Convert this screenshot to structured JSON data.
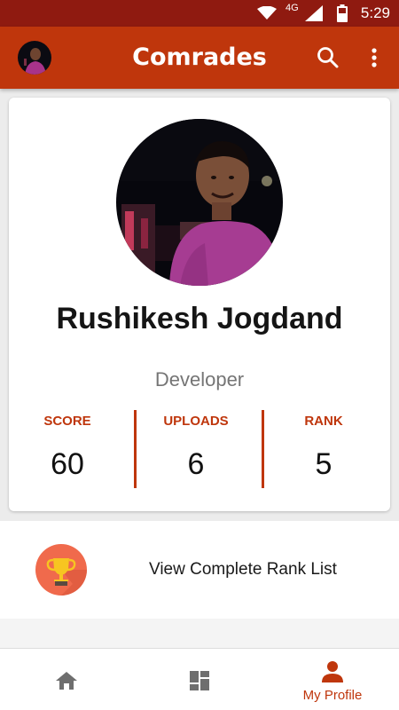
{
  "status_bar": {
    "network": "4G",
    "time": "5:29"
  },
  "app_bar": {
    "title": "Comrades"
  },
  "profile": {
    "name": "Rushikesh Jogdand",
    "role": "Developer"
  },
  "stats": [
    {
      "label": "SCORE",
      "value": "60"
    },
    {
      "label": "UPLOADS",
      "value": "6"
    },
    {
      "label": "RANK",
      "value": "5"
    }
  ],
  "rank_list": {
    "label": "View Complete Rank List"
  },
  "bottom_nav": {
    "items": [
      {
        "icon": "home-icon",
        "label": ""
      },
      {
        "icon": "dashboard-icon",
        "label": ""
      },
      {
        "icon": "person-icon",
        "label": "My Profile"
      }
    ]
  },
  "colors": {
    "status_bar": "#8f1a10",
    "primary": "#bf360c",
    "background": "#ececec"
  }
}
